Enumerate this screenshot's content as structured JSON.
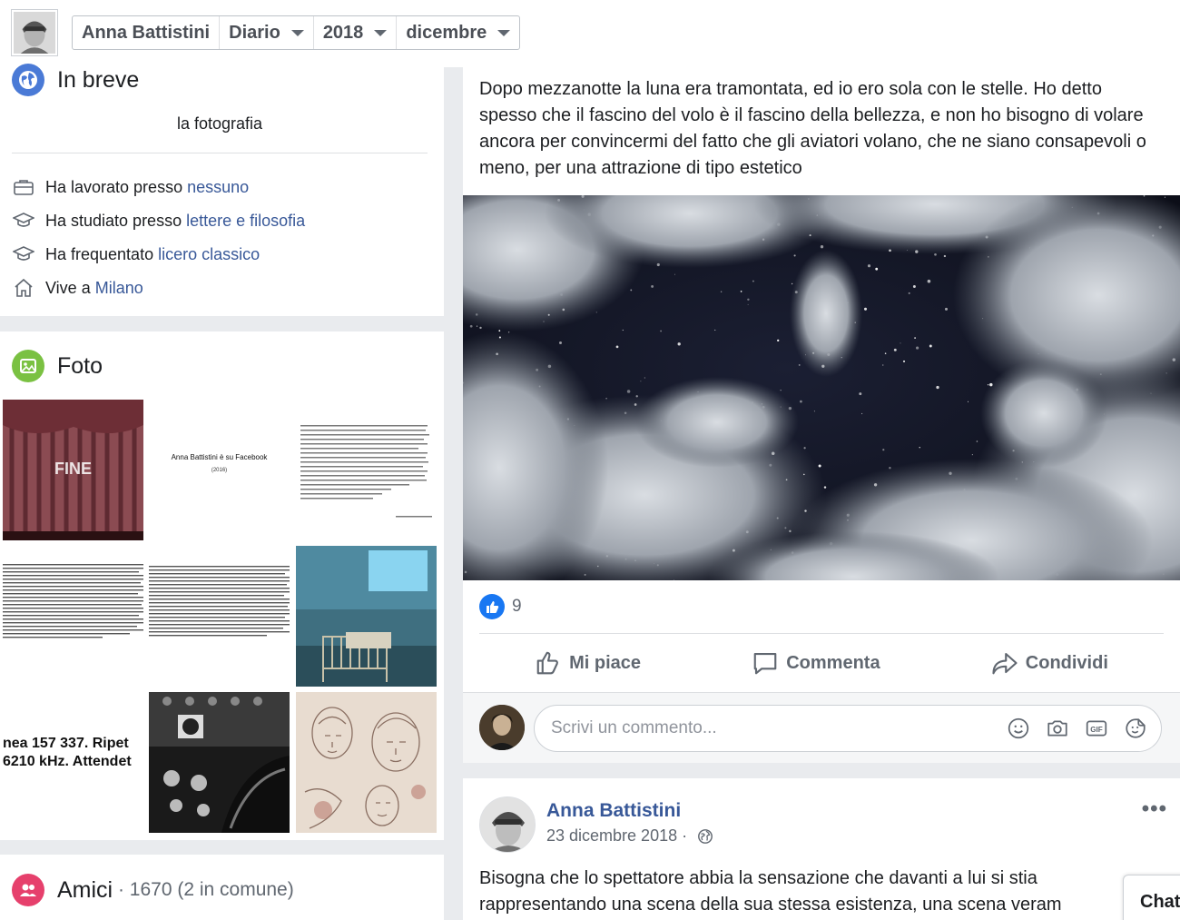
{
  "nav": {
    "profile_name": "Anna Battistini",
    "section": "Diario",
    "year": "2018",
    "month": "dicembre"
  },
  "intro": {
    "title": "In breve",
    "bio": "la fotografia",
    "work_prefix": "Ha lavorato presso ",
    "work_link": "nessuno",
    "study_prefix": "Ha studiato presso ",
    "study_link": "lettere e filosofia",
    "school_prefix": "Ha frequentato ",
    "school_link": "licero classico",
    "lives_prefix": "Vive a ",
    "lives_link": "Milano"
  },
  "photos": {
    "title": "Foto",
    "p1_text": "FINE",
    "p2_title": "Anna Battistini è su Facebook",
    "p2_sub": "(2016)",
    "p7_line1": "nea 157 337. Ripet",
    "p7_line2": "6210 kHz. Attendet"
  },
  "friends": {
    "title": "Amici",
    "separator": " · ",
    "count": "1670 (2 in comune)"
  },
  "post1": {
    "text": "Dopo mezzanotte la luna era tramontata, ed io ero sola con le stelle. Ho detto spesso che il fascino del volo è il fascino della bellezza, e non ho bisogno di volare ancora per convincermi del fatto che gli aviatori volano, che ne siano consapevoli o meno, per una attrazione di tipo estetico",
    "like_count": "9",
    "like_label": "Mi piace",
    "comment_label": "Commenta",
    "share_label": "Condividi",
    "comment_placeholder": "Scrivi un commento..."
  },
  "post2": {
    "author": "Anna Battistini",
    "date": "23 dicembre 2018",
    "date_sep": " · ",
    "more": "•••",
    "text_line1": "Bisogna che lo spettatore abbia la sensazione che davanti a lui si stia",
    "text_line2": "rappresentando una scena della sua stessa esistenza, una scena veram"
  },
  "chat": {
    "label": "Chat"
  },
  "icons": {
    "globe": "globe-icon",
    "photos": "photo-icon",
    "friends": "friends-icon",
    "like": "thumbs-up-icon",
    "comment": "speech-bubble-icon",
    "share": "share-arrow-icon",
    "emoji": "smiley-icon",
    "camera": "camera-icon",
    "gif": "gif-icon",
    "sticker": "sticker-icon"
  },
  "colors": {
    "link": "#385898",
    "globe_bg": "#4a7ad6",
    "photos_bg": "#7ac142",
    "friends_bg": "#e6406c",
    "like_blue": "#1877f2"
  }
}
